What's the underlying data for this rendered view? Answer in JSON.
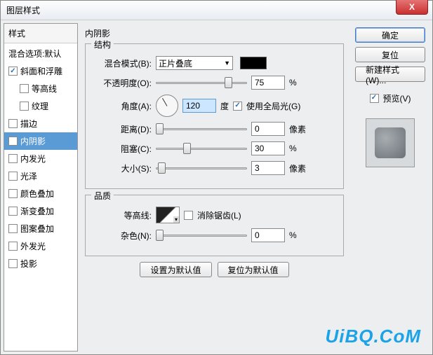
{
  "window": {
    "title": "图层样式"
  },
  "close_label": "X",
  "left": {
    "header": "样式",
    "blend_options": "混合选项:默认",
    "items": [
      {
        "label": "斜面和浮雕",
        "checked": true,
        "sub": false
      },
      {
        "label": "等高线",
        "checked": false,
        "sub": true
      },
      {
        "label": "纹理",
        "checked": false,
        "sub": true
      },
      {
        "label": "描边",
        "checked": false,
        "sub": false
      },
      {
        "label": "内阴影",
        "checked": true,
        "sub": false,
        "selected": true
      },
      {
        "label": "内发光",
        "checked": false,
        "sub": false
      },
      {
        "label": "光泽",
        "checked": false,
        "sub": false
      },
      {
        "label": "颜色叠加",
        "checked": false,
        "sub": false
      },
      {
        "label": "渐变叠加",
        "checked": false,
        "sub": false
      },
      {
        "label": "图案叠加",
        "checked": false,
        "sub": false
      },
      {
        "label": "外发光",
        "checked": false,
        "sub": false
      },
      {
        "label": "投影",
        "checked": false,
        "sub": false
      }
    ]
  },
  "panel": {
    "title": "内阴影",
    "structure": {
      "legend": "结构",
      "blend_mode_label": "混合模式(B):",
      "blend_mode_value": "正片叠底",
      "opacity_label": "不透明度(O):",
      "opacity_value": "75",
      "opacity_unit": "%",
      "angle_label": "角度(A):",
      "angle_value": "120",
      "angle_unit": "度",
      "global_light_label": "使用全局光(G)",
      "distance_label": "距离(D):",
      "distance_value": "0",
      "distance_unit": "像素",
      "choke_label": "阻塞(C):",
      "choke_value": "30",
      "choke_unit": "%",
      "size_label": "大小(S):",
      "size_value": "3",
      "size_unit": "像素"
    },
    "quality": {
      "legend": "品质",
      "contour_label": "等高线:",
      "antialias_label": "消除锯齿(L)",
      "noise_label": "杂色(N):",
      "noise_value": "0",
      "noise_unit": "%"
    },
    "reset_default": "设置为默认值",
    "restore_default": "复位为默认值"
  },
  "right": {
    "ok": "确定",
    "reset": "复位",
    "new_style": "新建样式(W)...",
    "preview_label": "预览(V)"
  },
  "watermark": "UiBQ.CoM"
}
